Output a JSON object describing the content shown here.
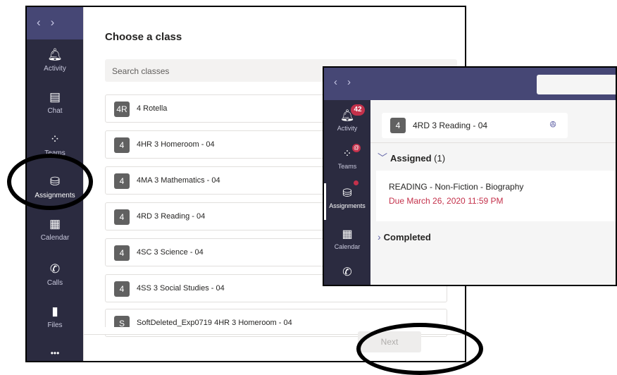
{
  "nav": {
    "back_glyph": "‹",
    "forward_glyph": "›"
  },
  "rail": [
    {
      "icon": "bell-icon",
      "label": "Activity"
    },
    {
      "icon": "chat-icon",
      "label": "Chat"
    },
    {
      "icon": "teams-icon",
      "label": "Teams"
    },
    {
      "icon": "backpack-icon",
      "label": "Assignments"
    },
    {
      "icon": "calendar-icon",
      "label": "Calendar"
    },
    {
      "icon": "phone-icon",
      "label": "Calls"
    },
    {
      "icon": "file-icon",
      "label": "Files"
    },
    {
      "icon": "more-icon",
      "label": "•••"
    }
  ],
  "choose_class": {
    "title": "Choose a class",
    "search_placeholder": "Search classes",
    "classes": [
      {
        "badge": "4R",
        "name": "4 Rotella"
      },
      {
        "badge": "4",
        "name": "4HR 3 Homeroom - 04"
      },
      {
        "badge": "4",
        "name": "4MA 3 Mathematics - 04"
      },
      {
        "badge": "4",
        "name": "4RD 3 Reading - 04"
      },
      {
        "badge": "4",
        "name": "4SC 3 Science - 04"
      },
      {
        "badge": "4",
        "name": "4SS 3 Social Studies - 04"
      },
      {
        "badge": "S",
        "name": "SoftDeleted_Exp0719 4HR 3 Homeroom - 04"
      }
    ],
    "next_label": "Next"
  },
  "overlay": {
    "activity_count": "42",
    "teams_badge": "@",
    "rail": [
      {
        "label": "Activity"
      },
      {
        "label": "Teams"
      },
      {
        "label": "Assignments"
      },
      {
        "label": "Calendar"
      }
    ],
    "class_badge": "4",
    "class_name": "4RD 3 Reading - 04",
    "assigned_label": "Assigned",
    "assigned_count": "(1)",
    "assignment_title": "READING - Non-Fiction - Biography",
    "assignment_due": "Due March 26, 2020 11:59 PM",
    "completed_label": "Completed"
  },
  "colors": {
    "brand": "#464775",
    "rail": "#2b2b40",
    "due": "#c4314b",
    "accent": "#6264a7"
  }
}
